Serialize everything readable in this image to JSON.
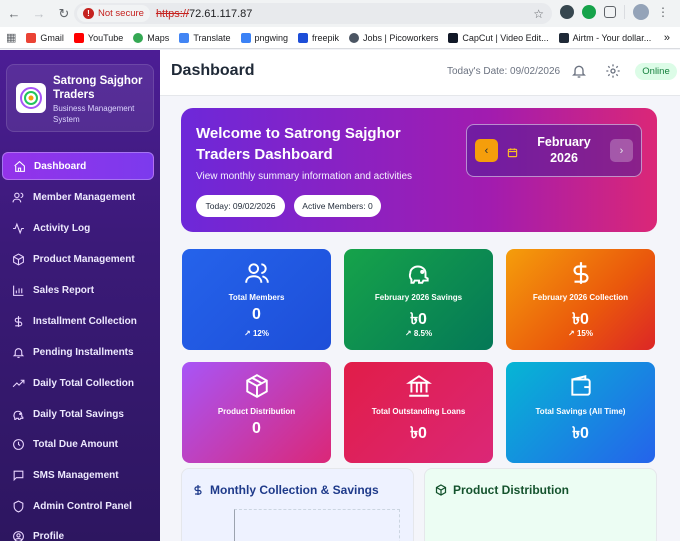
{
  "browser": {
    "security_label": "Not secure",
    "url_proto": "https://",
    "url_rest": "72.61.117.87",
    "bookmarks": [
      "Gmail",
      "YouTube",
      "Maps",
      "Translate",
      "pngwing",
      "freepik",
      "Jobs | Picoworkers",
      "CapCut | Video Edit...",
      "Airtm - Your dollar..."
    ],
    "more": "»"
  },
  "sidebar": {
    "brand_name": "Satrong Sajghor Traders",
    "brand_sub": "Business Management System",
    "items": [
      {
        "label": "Dashboard",
        "icon": "home-icon"
      },
      {
        "label": "Member Management",
        "icon": "users-icon"
      },
      {
        "label": "Activity Log",
        "icon": "activity-icon"
      },
      {
        "label": "Product Management",
        "icon": "box-icon"
      },
      {
        "label": "Sales Report",
        "icon": "bar-chart-icon"
      },
      {
        "label": "Installment Collection",
        "icon": "dollar-icon"
      },
      {
        "label": "Pending Installments",
        "icon": "bell-icon"
      },
      {
        "label": "Daily Total Collection",
        "icon": "trending-up-icon"
      },
      {
        "label": "Daily Total Savings",
        "icon": "piggy-bank-icon"
      },
      {
        "label": "Total Due Amount",
        "icon": "clock-icon"
      },
      {
        "label": "SMS Management",
        "icon": "message-icon"
      },
      {
        "label": "Admin Control Panel",
        "icon": "shield-icon"
      },
      {
        "label": "Profile",
        "icon": "user-icon"
      }
    ]
  },
  "header": {
    "title": "Dashboard",
    "date_text": "Today's Date: 09/02/2026",
    "status": "Online"
  },
  "welcome": {
    "title": "Welcome to Satrong Sajghor Traders Dashboard",
    "subtitle": "View monthly summary information and activities",
    "today_pill": "Today: 09/02/2026",
    "members_pill": "Active Members: 0",
    "month_line1": "February",
    "month_line2": "2026"
  },
  "cards": [
    {
      "label": "Total Members",
      "value": "0",
      "delta": "↗ 12%",
      "icon": "users-icon"
    },
    {
      "label": "February 2026 Savings",
      "value": "৳0",
      "delta": "↗ 8.5%",
      "icon": "piggy-bank-icon"
    },
    {
      "label": "February 2026 Collection",
      "value": "৳0",
      "delta": "↗ 15%",
      "icon": "dollar-icon"
    },
    {
      "label": "Product Distribution",
      "value": "0",
      "delta": "",
      "icon": "box-icon"
    },
    {
      "label": "Total Outstanding Loans",
      "value": "৳0",
      "delta": "",
      "icon": "bank-icon"
    },
    {
      "label": "Total Savings (All Time)",
      "value": "৳0",
      "delta": "",
      "icon": "wallet-icon"
    }
  ],
  "panels": {
    "monthly": "Monthly Collection & Savings",
    "product": "Product Distribution"
  },
  "colors": {
    "sidebar": "#4c1d95",
    "accent": "#7c3aed",
    "online_bg": "#dcfce7"
  }
}
